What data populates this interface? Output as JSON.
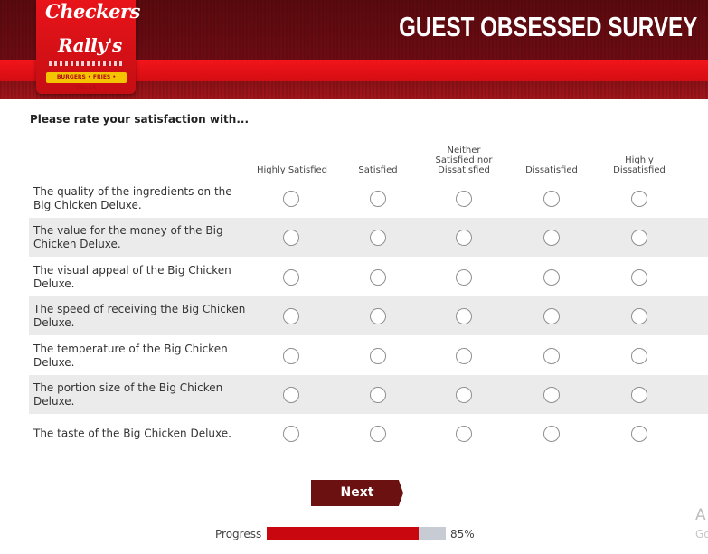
{
  "header": {
    "logo_brand_1": "Checkers",
    "logo_brand_2": "Rally's",
    "logo_tagline": "BURGERS • FRIES • COLAS",
    "survey_title": "GUEST OBSESSED SURVEY"
  },
  "question": {
    "title": "Please rate your satisfaction with..."
  },
  "columns": [
    "Highly Satisfied",
    "Satisfied",
    "Neither\nSatisfied nor\nDissatisfied",
    "Dissatisfied",
    "Highly\nDissatisfied"
  ],
  "rows": [
    "The quality of the ingredients on the Big Chicken Deluxe.",
    "The value for the money of the Big Chicken Deluxe.",
    "The visual appeal of the Big Chicken Deluxe.",
    "The speed of receiving the Big Chicken Deluxe.",
    "The temperature of the Big Chicken Deluxe.",
    "The portion size of the Big Chicken Deluxe.",
    "The taste of the Big Chicken Deluxe."
  ],
  "actions": {
    "next_label": "Next"
  },
  "progress": {
    "label": "Progress",
    "percent_text": "85%",
    "value": 0.85
  },
  "watermark": {
    "line1": "A",
    "line2": "Go"
  },
  "colors": {
    "brand_red": "#c8070e",
    "header_dark": "#6e0d12",
    "button": "#6b1111",
    "row_shade": "#ebebeb"
  }
}
